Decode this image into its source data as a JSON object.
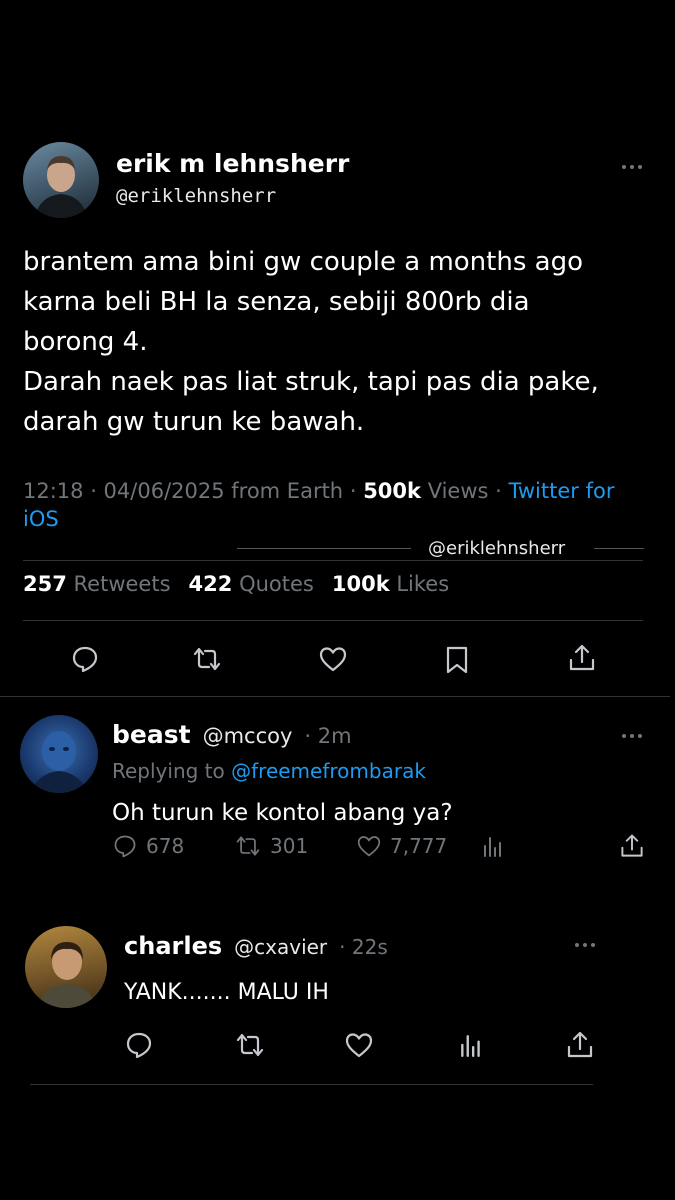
{
  "main_tweet": {
    "display_name": "erik m lehnsherr",
    "handle": "@eriklehnsherr",
    "body_lines": [
      "brantem ama bini gw couple a months ago",
      "karna beli BH la senza, sebiji 800rb dia",
      "borong 4.",
      "Darah naek pas liat struk, tapi pas dia pake,",
      "darah gw turun ke bawah."
    ],
    "timestamp": "12:18 · 04/06/2025 from Earth",
    "views_count": "500k",
    "views_label": "Views",
    "source_prefix": "·",
    "source": "Twitter for",
    "source_line2": "iOS",
    "watermark": "@eriklehnsherr",
    "stats": {
      "retweets": "257",
      "retweets_label": "Retweets",
      "quotes": "422",
      "quotes_label": "Quotes",
      "likes": "100k",
      "likes_label": "Likes"
    },
    "actions": [
      "reply-icon",
      "retweet-icon",
      "like-icon",
      "bookmark-icon",
      "share-icon"
    ]
  },
  "reply_1": {
    "display_name": "beast",
    "handle": "@mccoy",
    "time": "· 2m",
    "replying_prefix": "Replying to",
    "replying_to": "@freemefrombarak",
    "text": "Oh turun ke kontol abang ya?",
    "replies": "678",
    "retweets": "301",
    "likes": "7,777"
  },
  "reply_2": {
    "display_name": "charles",
    "handle": "@cxavier",
    "time": "· 22s",
    "text": "YANK....... MALU IH"
  },
  "colors": {
    "background": "#000000",
    "text": "#e7e9ea",
    "secondary": "#71767b",
    "link": "#1d9bf0",
    "divider": "#2f3336"
  }
}
